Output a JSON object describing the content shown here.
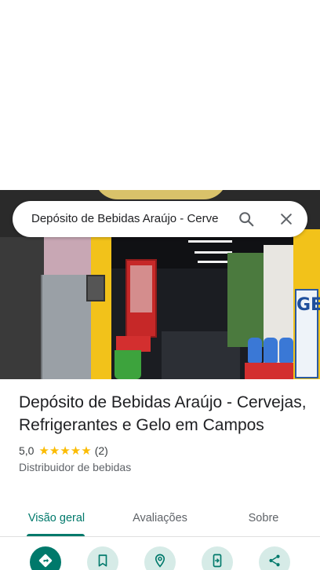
{
  "search": {
    "query": "Depósito de Bebidas Araújo - Cerve",
    "search_icon": "search-icon",
    "close_icon": "close-icon"
  },
  "photo": {
    "sign_text": "GELO"
  },
  "place": {
    "title": "Depósito de Bebidas Araújo - Cervejas, Refrigerantes e Gelo em Campos",
    "rating": "5,0",
    "stars": "★★★★★",
    "review_count": "(2)",
    "category": "Distribuidor de bebidas"
  },
  "tabs": [
    {
      "label": "Visão geral",
      "active": true
    },
    {
      "label": "Avaliações",
      "active": false
    },
    {
      "label": "Sobre",
      "active": false
    }
  ],
  "actions": [
    {
      "icon": "directions-icon"
    },
    {
      "icon": "bookmark-icon"
    },
    {
      "icon": "nearby-icon"
    },
    {
      "icon": "send-to-phone-icon"
    },
    {
      "icon": "share-icon"
    }
  ],
  "colors": {
    "accent": "#00796b",
    "accent_light": "#d6ebe7",
    "star": "#fbbc04"
  }
}
